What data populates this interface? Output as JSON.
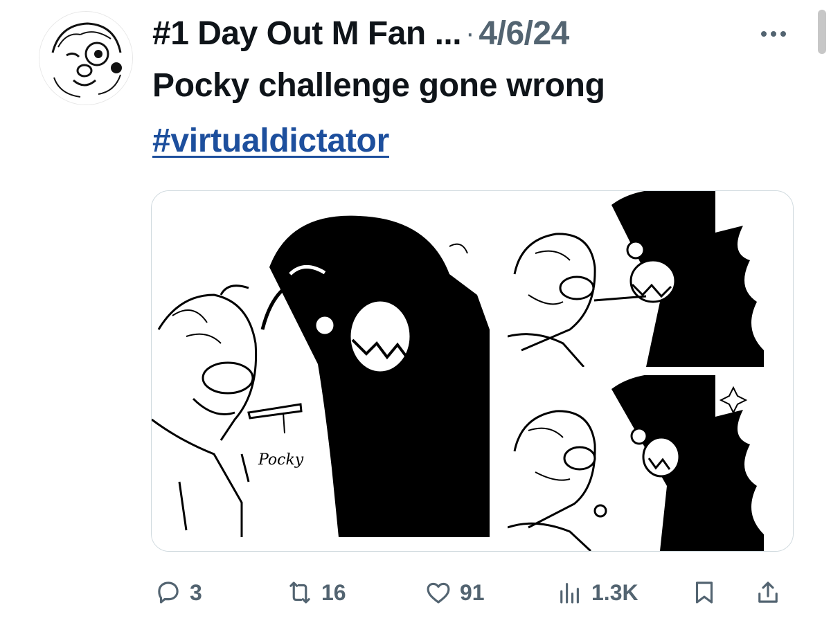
{
  "tweet": {
    "author": "#1 Day Out M Fan ...",
    "separator": "·",
    "date": "4/6/24",
    "text": "Pocky challenge gone wrong",
    "hashtag": "#virtualdictator"
  },
  "media": {
    "left_annotation": "Pocky"
  },
  "actions": {
    "replies": "3",
    "reposts": "16",
    "likes": "91",
    "views": "1.3K"
  },
  "icons": {
    "reply": "reply-icon",
    "repost": "repost-icon",
    "like": "heart-icon",
    "views": "views-icon",
    "bookmark": "bookmark-icon",
    "share": "share-icon",
    "more": "more-icon"
  },
  "colors": {
    "text": "#0f1419",
    "muted": "#536471",
    "hashtag": "#1d4f9d",
    "border": "#cfd9de"
  }
}
